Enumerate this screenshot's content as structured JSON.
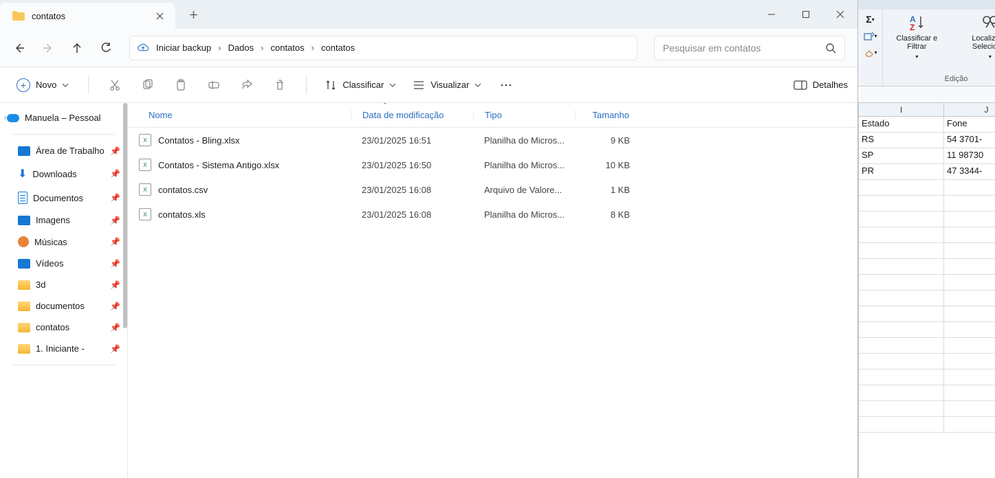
{
  "tab": {
    "title": "contatos"
  },
  "breadcrumb": {
    "root": "Iniciar backup",
    "items": [
      "Dados",
      "contatos",
      "contatos"
    ]
  },
  "search": {
    "placeholder": "Pesquisar em contatos"
  },
  "toolbar": {
    "new_label": "Novo",
    "sort_label": "Classificar",
    "view_label": "Visualizar",
    "details_label": "Detalhes"
  },
  "sidebar": {
    "onedrive": "Manuela – Pessoal",
    "items": [
      "Área de Trabalho",
      "Downloads",
      "Documentos",
      "Imagens",
      "Músicas",
      "Vídeos",
      "3d",
      "documentos",
      "contatos",
      "1. Iniciante - "
    ]
  },
  "columns": {
    "name": "Nome",
    "modified": "Data de modificação",
    "type": "Tipo",
    "size": "Tamanho"
  },
  "files": [
    {
      "name": "Contatos - Bling.xlsx",
      "modified": "23/01/2025 16:51",
      "type": "Planilha do Micros...",
      "size": "9 KB"
    },
    {
      "name": "Contatos - Sistema Antigo.xlsx",
      "modified": "23/01/2025 16:50",
      "type": "Planilha do Micros...",
      "size": "10 KB"
    },
    {
      "name": "contatos.csv",
      "modified": "23/01/2025 16:08",
      "type": "Arquivo de Valore...",
      "size": "1 KB"
    },
    {
      "name": "contatos.xls",
      "modified": "23/01/2025 16:08",
      "type": "Planilha do Micros...",
      "size": "8 KB"
    }
  ],
  "excel": {
    "ribbon": {
      "sort_filter": "Classificar e Filtrar",
      "find_select": "Localizar e Selecionar",
      "group_label": "Edição"
    },
    "columns": [
      "I",
      "J"
    ],
    "rows": [
      [
        "Estado",
        "Fone"
      ],
      [
        "RS",
        "54 3701-"
      ],
      [
        "SP",
        "11 98730"
      ],
      [
        "PR",
        "47 3344-"
      ]
    ]
  }
}
